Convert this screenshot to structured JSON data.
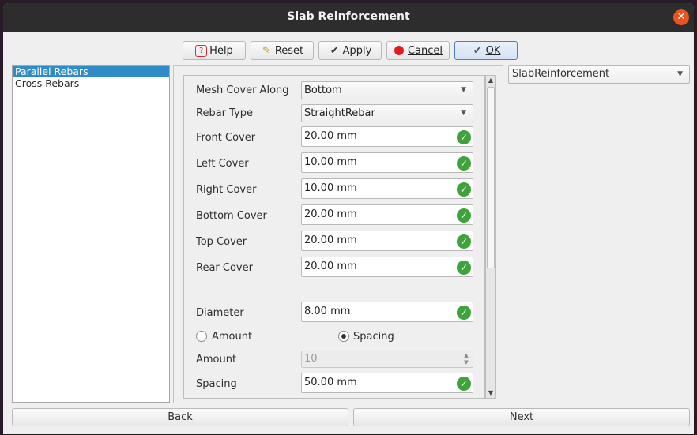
{
  "window": {
    "title": "Slab Reinforcement",
    "close_symbol": "✕"
  },
  "toolbar": {
    "help_label": "Help",
    "reset_label": "Reset",
    "apply_label": "Apply",
    "cancel_label": "Cancel",
    "ok_label": "OK"
  },
  "sidebar": {
    "items": [
      {
        "label": "Parallel Rebars",
        "selected": true
      },
      {
        "label": "Cross Rebars",
        "selected": false
      }
    ]
  },
  "type_select": {
    "value": "SlabReinforcement"
  },
  "form": {
    "mesh_cover_along": {
      "label": "Mesh Cover Along",
      "value": "Bottom"
    },
    "rebar_type": {
      "label": "Rebar Type",
      "value": "StraightRebar"
    },
    "front_cover": {
      "label": "Front Cover",
      "value": "20.00 mm"
    },
    "left_cover": {
      "label": "Left Cover",
      "value": "10.00 mm"
    },
    "right_cover": {
      "label": "Right Cover",
      "value": "10.00 mm"
    },
    "bottom_cover": {
      "label": "Bottom Cover",
      "value": "20.00 mm"
    },
    "top_cover": {
      "label": "Top Cover",
      "value": "20.00 mm"
    },
    "rear_cover": {
      "label": "Rear Cover",
      "value": "20.00 mm"
    },
    "diameter": {
      "label": "Diameter",
      "value": "8.00 mm"
    },
    "radio_amount": {
      "label": "Amount",
      "checked": false
    },
    "radio_spacing": {
      "label": "Spacing",
      "checked": true
    },
    "amount": {
      "label": "Amount",
      "value": "10"
    },
    "spacing": {
      "label": "Spacing",
      "value": "50.00 mm"
    }
  },
  "nav": {
    "back_label": "Back",
    "next_label": "Next"
  },
  "colors": {
    "accent": "#308cc6",
    "close": "#e95420",
    "valid": "#3fa33b"
  }
}
